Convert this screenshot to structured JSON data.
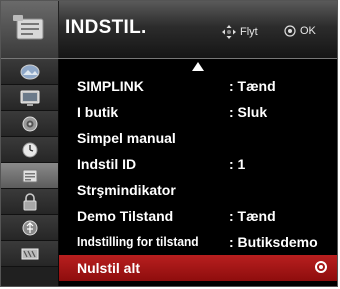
{
  "header": {
    "title": "INDSTIL.",
    "hint_move": "Flyt",
    "hint_ok": "OK",
    "icon": "setup-icon"
  },
  "side_icons": [
    {
      "name": "picture-icon"
    },
    {
      "name": "tv-icon"
    },
    {
      "name": "audio-icon"
    },
    {
      "name": "time-icon"
    },
    {
      "name": "setup-icon",
      "active": true
    },
    {
      "name": "lock-icon"
    },
    {
      "name": "usb-icon"
    },
    {
      "name": "input-icon"
    }
  ],
  "menu": {
    "items": [
      {
        "label": "SIMPLINK",
        "value": ": Tænd"
      },
      {
        "label": "I butik",
        "value": ": Sluk"
      },
      {
        "label": "Simpel manual",
        "value": ""
      },
      {
        "label": "Indstil ID",
        "value": ": 1"
      },
      {
        "label": "Strşmindikator",
        "value": ""
      },
      {
        "label": "Demo Tilstand",
        "value": ": Tænd"
      },
      {
        "label": "Indstilling for tilstand",
        "value": ": Butiksdemo"
      },
      {
        "label": "Nulstil alt",
        "value": "",
        "selected": true
      }
    ]
  },
  "colors": {
    "selected": "#a01515",
    "background": "#000000",
    "text": "#ffffff"
  }
}
